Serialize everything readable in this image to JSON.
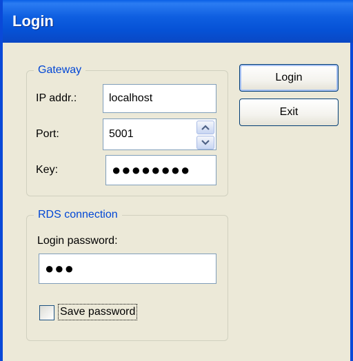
{
  "window": {
    "title": "Login"
  },
  "gateway": {
    "legend": "Gateway",
    "ip_label": "IP addr.:",
    "ip_value": "localhost",
    "port_label": "Port:",
    "port_value": "5001",
    "key_label": "Key:",
    "key_value": "●●●●●●●●"
  },
  "rds": {
    "legend": "RDS connection",
    "password_label": "Login password:",
    "password_value": "●●●",
    "save_password_label": "Save password",
    "save_password_checked": false
  },
  "buttons": {
    "login": "Login",
    "exit": "Exit"
  },
  "colors": {
    "title_bar": "#0a5fe6",
    "legend_text": "#0046d5",
    "dialog_bg": "#ece9d8"
  },
  "icons": {
    "spin_up": "chevron-up-icon",
    "spin_down": "chevron-down-icon"
  }
}
